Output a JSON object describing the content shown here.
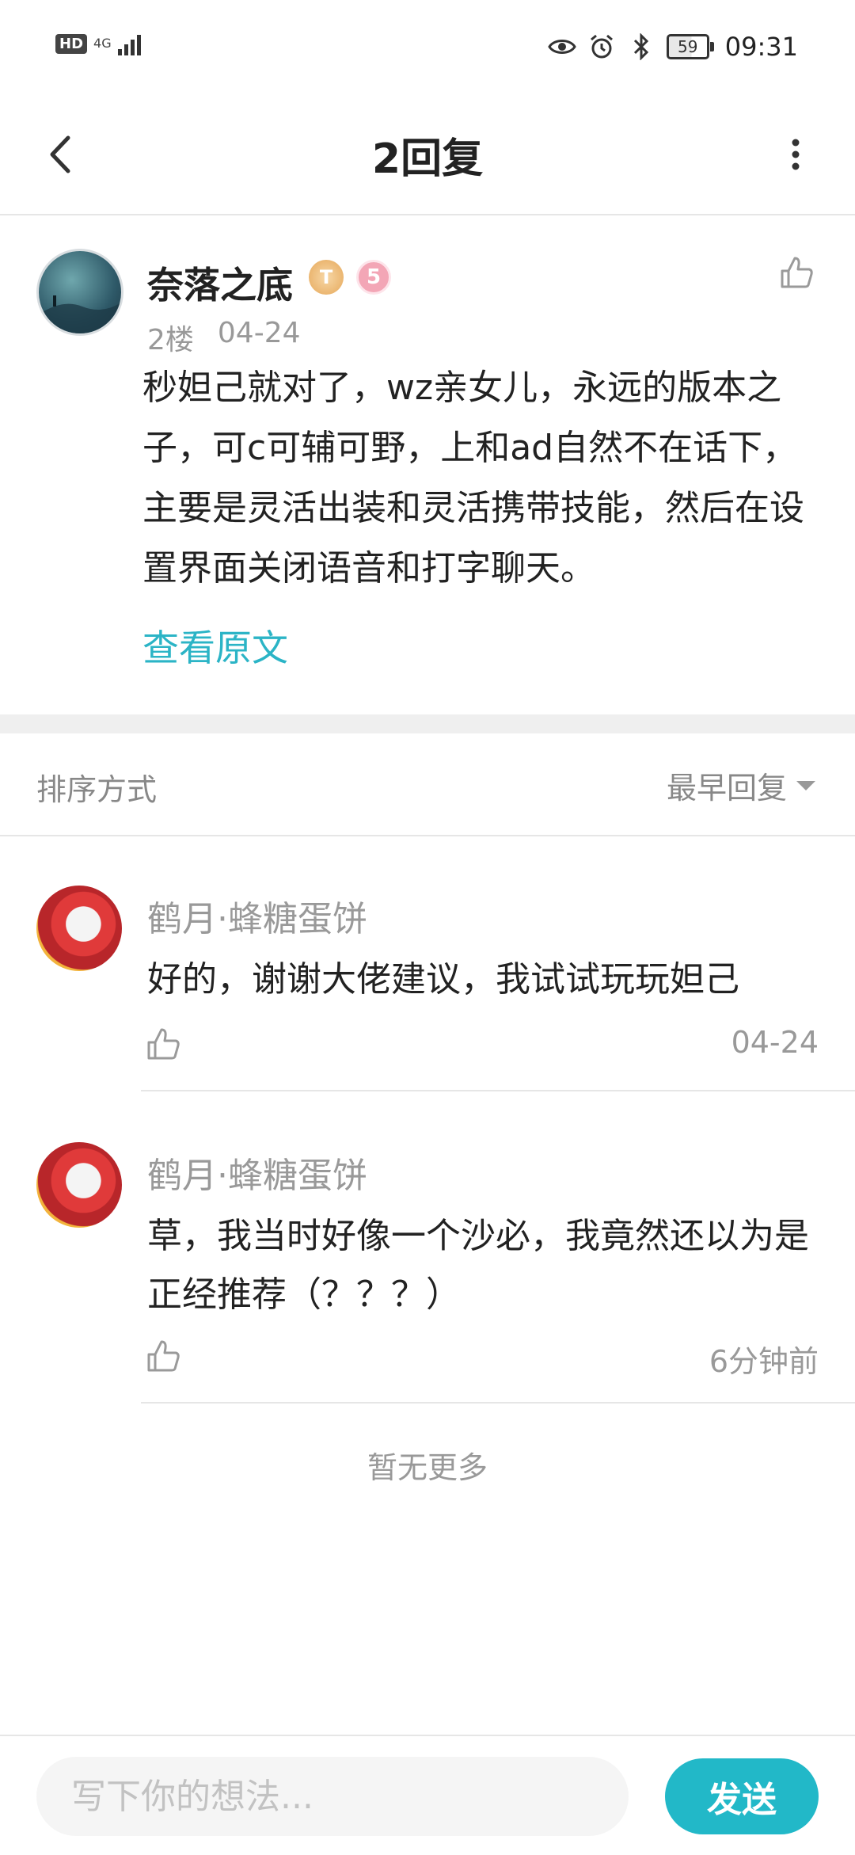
{
  "status_bar": {
    "hd_label": "HD",
    "network_label": "4G",
    "battery_level": "59",
    "time": "09:31",
    "icons": [
      "eye-icon",
      "alarm-icon",
      "bluetooth-icon",
      "battery-icon"
    ]
  },
  "header": {
    "title": "2回复",
    "back_icon": "back-arrow-icon",
    "more_icon": "more-vertical-icon"
  },
  "main_comment": {
    "author": "奈落之底",
    "badge_t": "T",
    "badge_level": "5",
    "floor": "2楼",
    "date": "04-24",
    "text": "秒妲己就对了，wz亲女儿，永远的版本之子，可c可辅可野，上和ad自然不在话下，主要是灵活出装和灵活携带技能，然后在设置界面关闭语音和打字聊天。",
    "view_original": "查看原文"
  },
  "sort": {
    "label": "排序方式",
    "selected": "最早回复"
  },
  "replies": [
    {
      "author": "鹤月·蜂糖蛋饼",
      "text": "好的，谢谢大佬建议，我试试玩玩妲己",
      "time": "04-24"
    },
    {
      "author": "鹤月·蜂糖蛋饼",
      "text": "草，我当时好像一个沙必，我竟然还以为是正经推荐（？？？）",
      "time": "6分钟前"
    }
  ],
  "footer": {
    "no_more": "暂无更多"
  },
  "input_bar": {
    "placeholder": "写下你的想法...",
    "send_label": "发送"
  },
  "colors": {
    "accent": "#22b8c8",
    "link": "#2bb4c6",
    "muted_text": "#999999"
  }
}
